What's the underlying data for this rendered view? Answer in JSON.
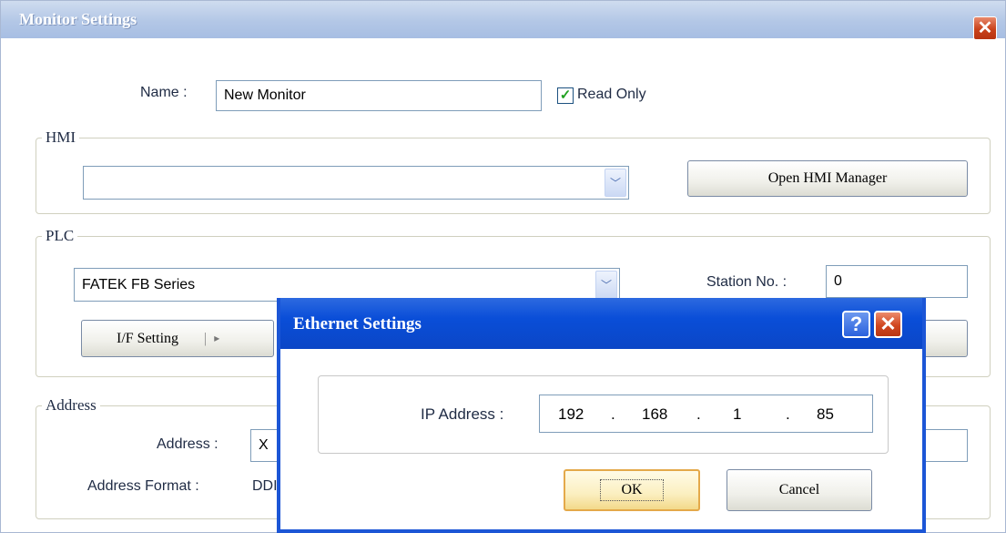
{
  "window": {
    "title": "Monitor Settings",
    "close_glyph": "✕"
  },
  "name_field": {
    "label": "Name :",
    "value": "New Monitor"
  },
  "read_only": {
    "label": "Read Only",
    "checked": true
  },
  "hmi": {
    "group_title": "HMI",
    "selected": "",
    "open_manager_label": "Open HMI Manager"
  },
  "plc": {
    "group_title": "PLC",
    "selected": "FATEK FB Series",
    "station_label": "Station No. :",
    "station_value": "0",
    "if_setting_label": "I/F Setting",
    "if_setting_arrow": "▸"
  },
  "address": {
    "group_title": "Address",
    "address_label": "Address :",
    "address_value": "X",
    "format_label": "Address Format :",
    "format_value": "DDI"
  },
  "ethernet_dialog": {
    "title": "Ethernet Settings",
    "help_glyph": "?",
    "close_glyph": "✕",
    "ip_label": "IP Address :",
    "ip_octets": [
      "192",
      "168",
      "1",
      "85"
    ],
    "ip_dot": ".",
    "ok_label": "OK",
    "cancel_label": "Cancel"
  },
  "icons": {
    "combo_arrow": "chevron-down-icon",
    "check": "checkmark-icon"
  }
}
